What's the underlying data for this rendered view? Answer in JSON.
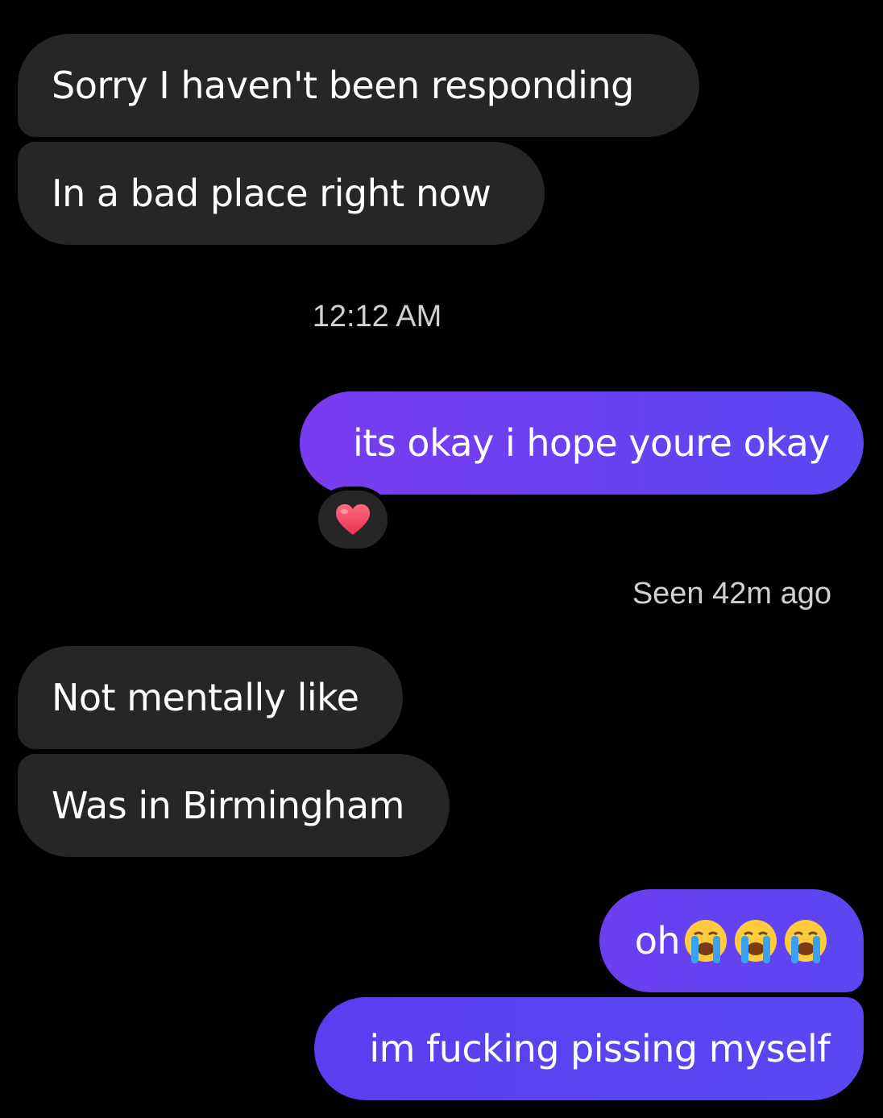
{
  "colors": {
    "background": "#000000",
    "incoming_bubble": "#262626",
    "outgoing_gradient_start": "#7a3cf0",
    "outgoing_gradient_end": "#5a47f2",
    "heart": "#f0445f"
  },
  "messages": {
    "in_1": "Sorry I haven't been responding",
    "in_2": "In a bad place right now",
    "timestamp": "12:12 AM",
    "out_1": "its okay i hope youre okay",
    "out_1_reaction": "heart-emoji",
    "seen": "Seen 42m ago",
    "in_3": "Not mentally like",
    "in_4": "Was in Birmingham",
    "out_2_text": "oh",
    "out_2_emojis": [
      "loudly-crying-face-emoji",
      "loudly-crying-face-emoji",
      "loudly-crying-face-emoji"
    ],
    "out_3": "im fucking pissing myself"
  }
}
